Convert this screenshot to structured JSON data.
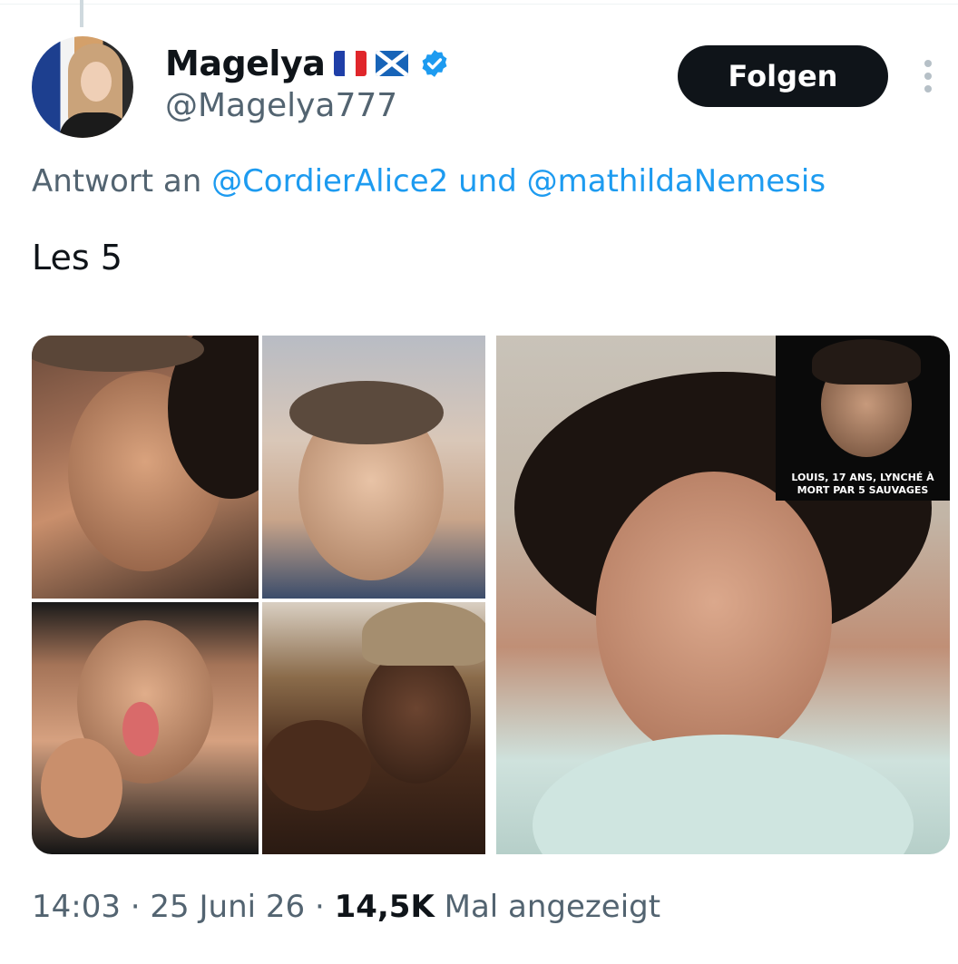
{
  "tweet": {
    "author": {
      "display_name": "Magelya",
      "handle": "@Magelya777",
      "flags": [
        "flag-france-icon",
        "flag-scotland-icon"
      ],
      "verified": true
    },
    "follow_label": "Folgen",
    "reply_to": {
      "prefix": "Antwort an",
      "mention_1": "@CordierAlice2",
      "conjunction": "und",
      "mention_2": "@mathildaNemesis"
    },
    "text": "Les 5",
    "media": {
      "inset_caption": "LOUIS, 17 ANS, LYNCHÉ À\nMORT PAR 5 SAUVAGES"
    },
    "meta": {
      "time": "14:03",
      "separator": "·",
      "date": "25 Juni 26",
      "views_count": "14,5K",
      "views_label": "Mal angezeigt"
    }
  },
  "colors": {
    "text_primary": "#0f1419",
    "text_secondary": "#536471",
    "link": "#1d9bf0",
    "verified": "#1d9bf0",
    "button_bg": "#0f1419"
  }
}
